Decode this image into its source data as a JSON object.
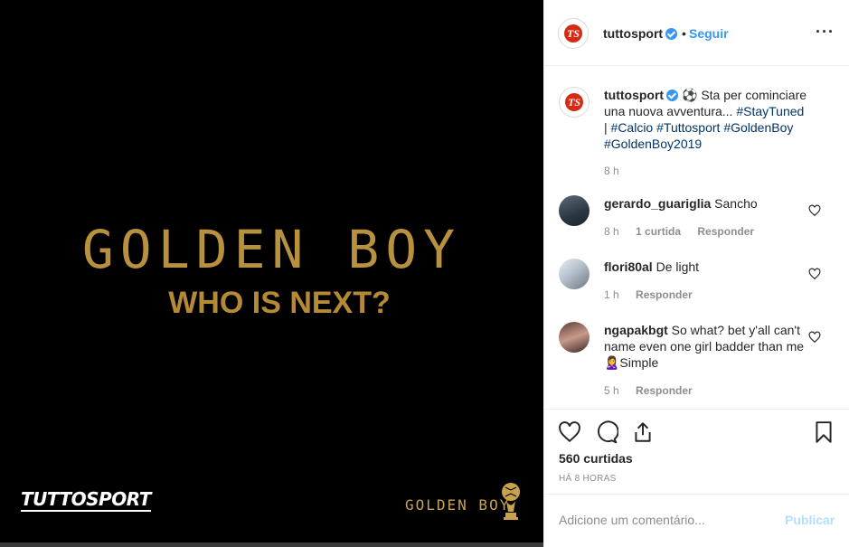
{
  "media": {
    "headline": "GOLDEN BOY",
    "subheadline": "WHO IS NEXT?",
    "brand_logo": "TUTTOSPORT",
    "corner_logo": "GOLDEN BOY"
  },
  "header": {
    "username": "tuttosport",
    "separator": "•",
    "follow_label": "Seguir",
    "more_icon": "more-options-icon",
    "avatar_text": "TS"
  },
  "caption": {
    "username": "tuttosport",
    "text": "Sta per cominciare una nuova avventura... ",
    "tags": [
      "#StayTuned",
      "#Calcio",
      "#Tuttosport",
      "#GoldenBoy",
      "#GoldenBoy2019"
    ],
    "separator": "|",
    "time": "8 h"
  },
  "comments": [
    {
      "username": "gerardo_guariglia",
      "text": "Sancho",
      "time": "8 h",
      "likes": "1 curtida",
      "reply": "Responder"
    },
    {
      "username": "flori80al",
      "text": "De light",
      "time": "1 h",
      "likes": "",
      "reply": "Responder"
    },
    {
      "username": "ngapakbgt",
      "text": "So what? bet y'all can't name even one girl badder than me 🙎‍♀️Simple",
      "time": "5 h",
      "likes": "",
      "reply": "Responder"
    }
  ],
  "actions": {
    "likes": "560 curtidas",
    "time_ago": "HÁ 8 HORAS"
  },
  "add_comment": {
    "placeholder": "Adicione um comentário...",
    "publish_label": "Publicar"
  },
  "colors": {
    "gold": "#b8913f",
    "link": "#3897f0",
    "hashtag": "#003569",
    "publish_disabled": "#b2dffc"
  }
}
